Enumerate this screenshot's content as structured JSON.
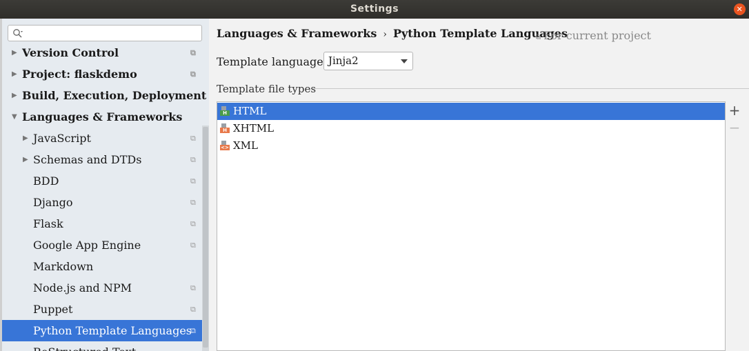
{
  "window": {
    "title": "Settings"
  },
  "search": {
    "placeholder": ""
  },
  "sidebar": {
    "items": [
      {
        "label": "Version Control",
        "bold": true,
        "level": 0,
        "arrow": "▶",
        "scoped": true
      },
      {
        "label": "Project: flaskdemo",
        "bold": true,
        "level": 0,
        "arrow": "▶",
        "scoped": true
      },
      {
        "label": "Build, Execution, Deployment",
        "bold": true,
        "level": 0,
        "arrow": "▶",
        "scoped": false
      },
      {
        "label": "Languages & Frameworks",
        "bold": true,
        "level": 0,
        "arrow": "▼",
        "scoped": false
      },
      {
        "label": "JavaScript",
        "bold": false,
        "level": 1,
        "arrow": "▶",
        "scoped": true
      },
      {
        "label": "Schemas and DTDs",
        "bold": false,
        "level": 1,
        "arrow": "▶",
        "scoped": true
      },
      {
        "label": "BDD",
        "bold": false,
        "level": 1,
        "arrow": "",
        "scoped": true
      },
      {
        "label": "Django",
        "bold": false,
        "level": 1,
        "arrow": "",
        "scoped": true
      },
      {
        "label": "Flask",
        "bold": false,
        "level": 1,
        "arrow": "",
        "scoped": true
      },
      {
        "label": "Google App Engine",
        "bold": false,
        "level": 1,
        "arrow": "",
        "scoped": true
      },
      {
        "label": "Markdown",
        "bold": false,
        "level": 1,
        "arrow": "",
        "scoped": false
      },
      {
        "label": "Node.js and NPM",
        "bold": false,
        "level": 1,
        "arrow": "",
        "scoped": true
      },
      {
        "label": "Puppet",
        "bold": false,
        "level": 1,
        "arrow": "",
        "scoped": true
      },
      {
        "label": "Python Template Languages",
        "bold": false,
        "level": 1,
        "arrow": "",
        "scoped": true,
        "selected": true
      },
      {
        "label": "ReStructured Text",
        "bold": false,
        "level": 1,
        "arrow": "",
        "scoped": false
      }
    ],
    "scope_icon": "⧉"
  },
  "breadcrumb": {
    "parent": "Languages & Frameworks",
    "separator": "›",
    "current": "Python Template Languages"
  },
  "scope_note": {
    "icon": "⧉",
    "label": "For current project"
  },
  "template_language": {
    "label": "Template language:",
    "value": "Jinja2"
  },
  "file_types": {
    "title": "Template file types",
    "items": [
      {
        "label": "HTML",
        "badge": "H",
        "badge_color": "#4a9c48",
        "selected": true
      },
      {
        "label": "XHTML",
        "badge": "H",
        "badge_color": "#e8794a",
        "selected": false
      },
      {
        "label": "XML",
        "badge": "<>",
        "badge_color": "#e8794a",
        "selected": false
      }
    ],
    "add_label": "+",
    "remove_label": "−"
  }
}
